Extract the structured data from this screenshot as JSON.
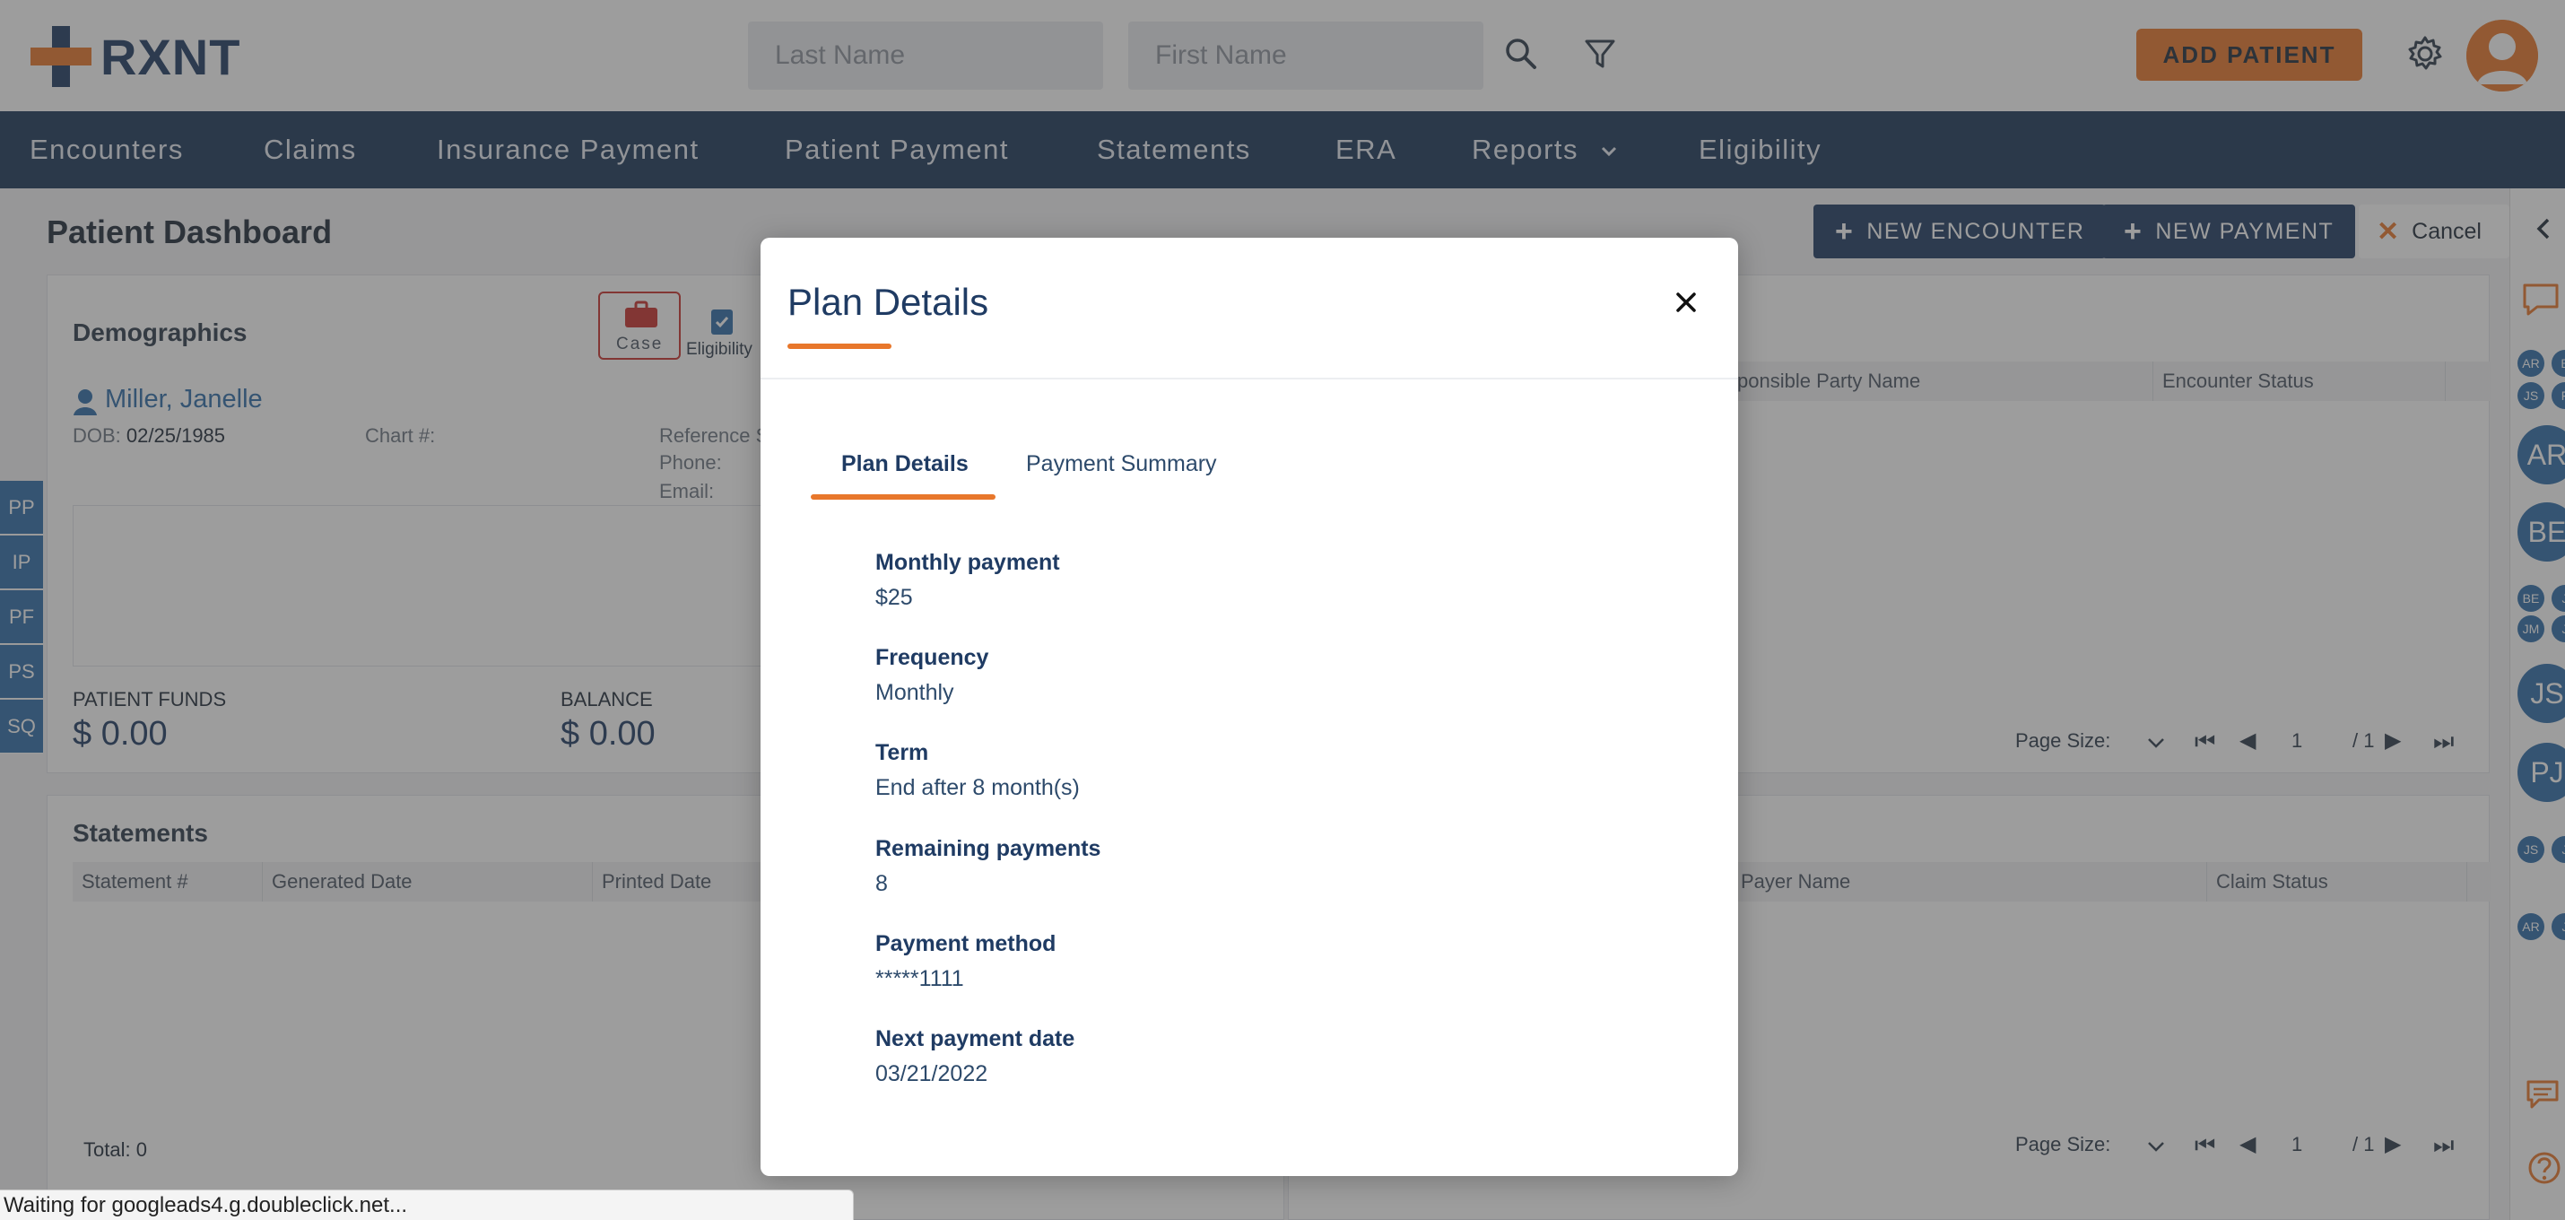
{
  "header": {
    "logo_text": "RXNT",
    "last_name_placeholder": "Last Name",
    "first_name_placeholder": "First Name",
    "add_patient_label": "ADD PATIENT"
  },
  "nav": {
    "items": [
      "Encounters",
      "Claims",
      "Insurance Payment",
      "Patient Payment",
      "Statements",
      "ERA",
      "Reports",
      "Eligibility"
    ]
  },
  "page": {
    "title": "Patient Dashboard",
    "new_encounter_label": "NEW ENCOUNTER",
    "new_payment_label": "NEW PAYMENT",
    "cancel_label": "Cancel"
  },
  "demographics": {
    "title": "Demographics",
    "case_label": "Case",
    "eligibility_label": "Eligibility",
    "patient_name": "Miller, Janelle",
    "dob_label": "DOB:",
    "dob_value": "02/25/1985",
    "chart_label": "Chart #:",
    "reference_label": "Reference S",
    "phone_label": "Phone:",
    "email_label": "Email:",
    "patient_funds_label": "PATIENT FUNDS",
    "patient_funds_value": "$ 0.00",
    "balance_label": "BALANCE",
    "balance_value": "$ 0.00"
  },
  "side_tabs": [
    "PP",
    "IP",
    "PF",
    "PS",
    "SQ"
  ],
  "encounters_table": {
    "columns": [
      "ponsible Party Name",
      "Encounter Status"
    ]
  },
  "statements": {
    "title": "Statements",
    "columns": [
      "Statement #",
      "Generated Date",
      "Printed Date"
    ],
    "total": "Total: 0"
  },
  "claims_table": {
    "columns": [
      "Payer Name",
      "Claim Status"
    ]
  },
  "pager": {
    "page_size_label": "Page Size:",
    "current_page": "1",
    "total_pages": "/ 1"
  },
  "rail": {
    "small_initials": [
      "AR",
      "B",
      "JS",
      "F",
      "BE",
      "J",
      "JM",
      "J",
      "JS",
      "J",
      "AR",
      "J"
    ],
    "large_initials": [
      "AR",
      "BE",
      "JS",
      "PJ"
    ]
  },
  "modal": {
    "title": "Plan Details",
    "tabs": [
      "Plan Details",
      "Payment Summary"
    ],
    "fields": [
      {
        "label": "Monthly payment",
        "value": "$25"
      },
      {
        "label": "Frequency",
        "value": "Monthly"
      },
      {
        "label": "Term",
        "value": "End after 8 month(s)"
      },
      {
        "label": "Remaining payments",
        "value": "8"
      },
      {
        "label": "Payment method",
        "value": "*****1111"
      },
      {
        "label": "Next payment date",
        "value": "03/21/2022"
      }
    ]
  },
  "status_bar": {
    "text": "Waiting for googleads4.g.doubleclick.net..."
  },
  "colors": {
    "brand_orange": "#e8772b",
    "brand_navy": "#1b3658",
    "accent_blue": "#2e6ca8"
  }
}
